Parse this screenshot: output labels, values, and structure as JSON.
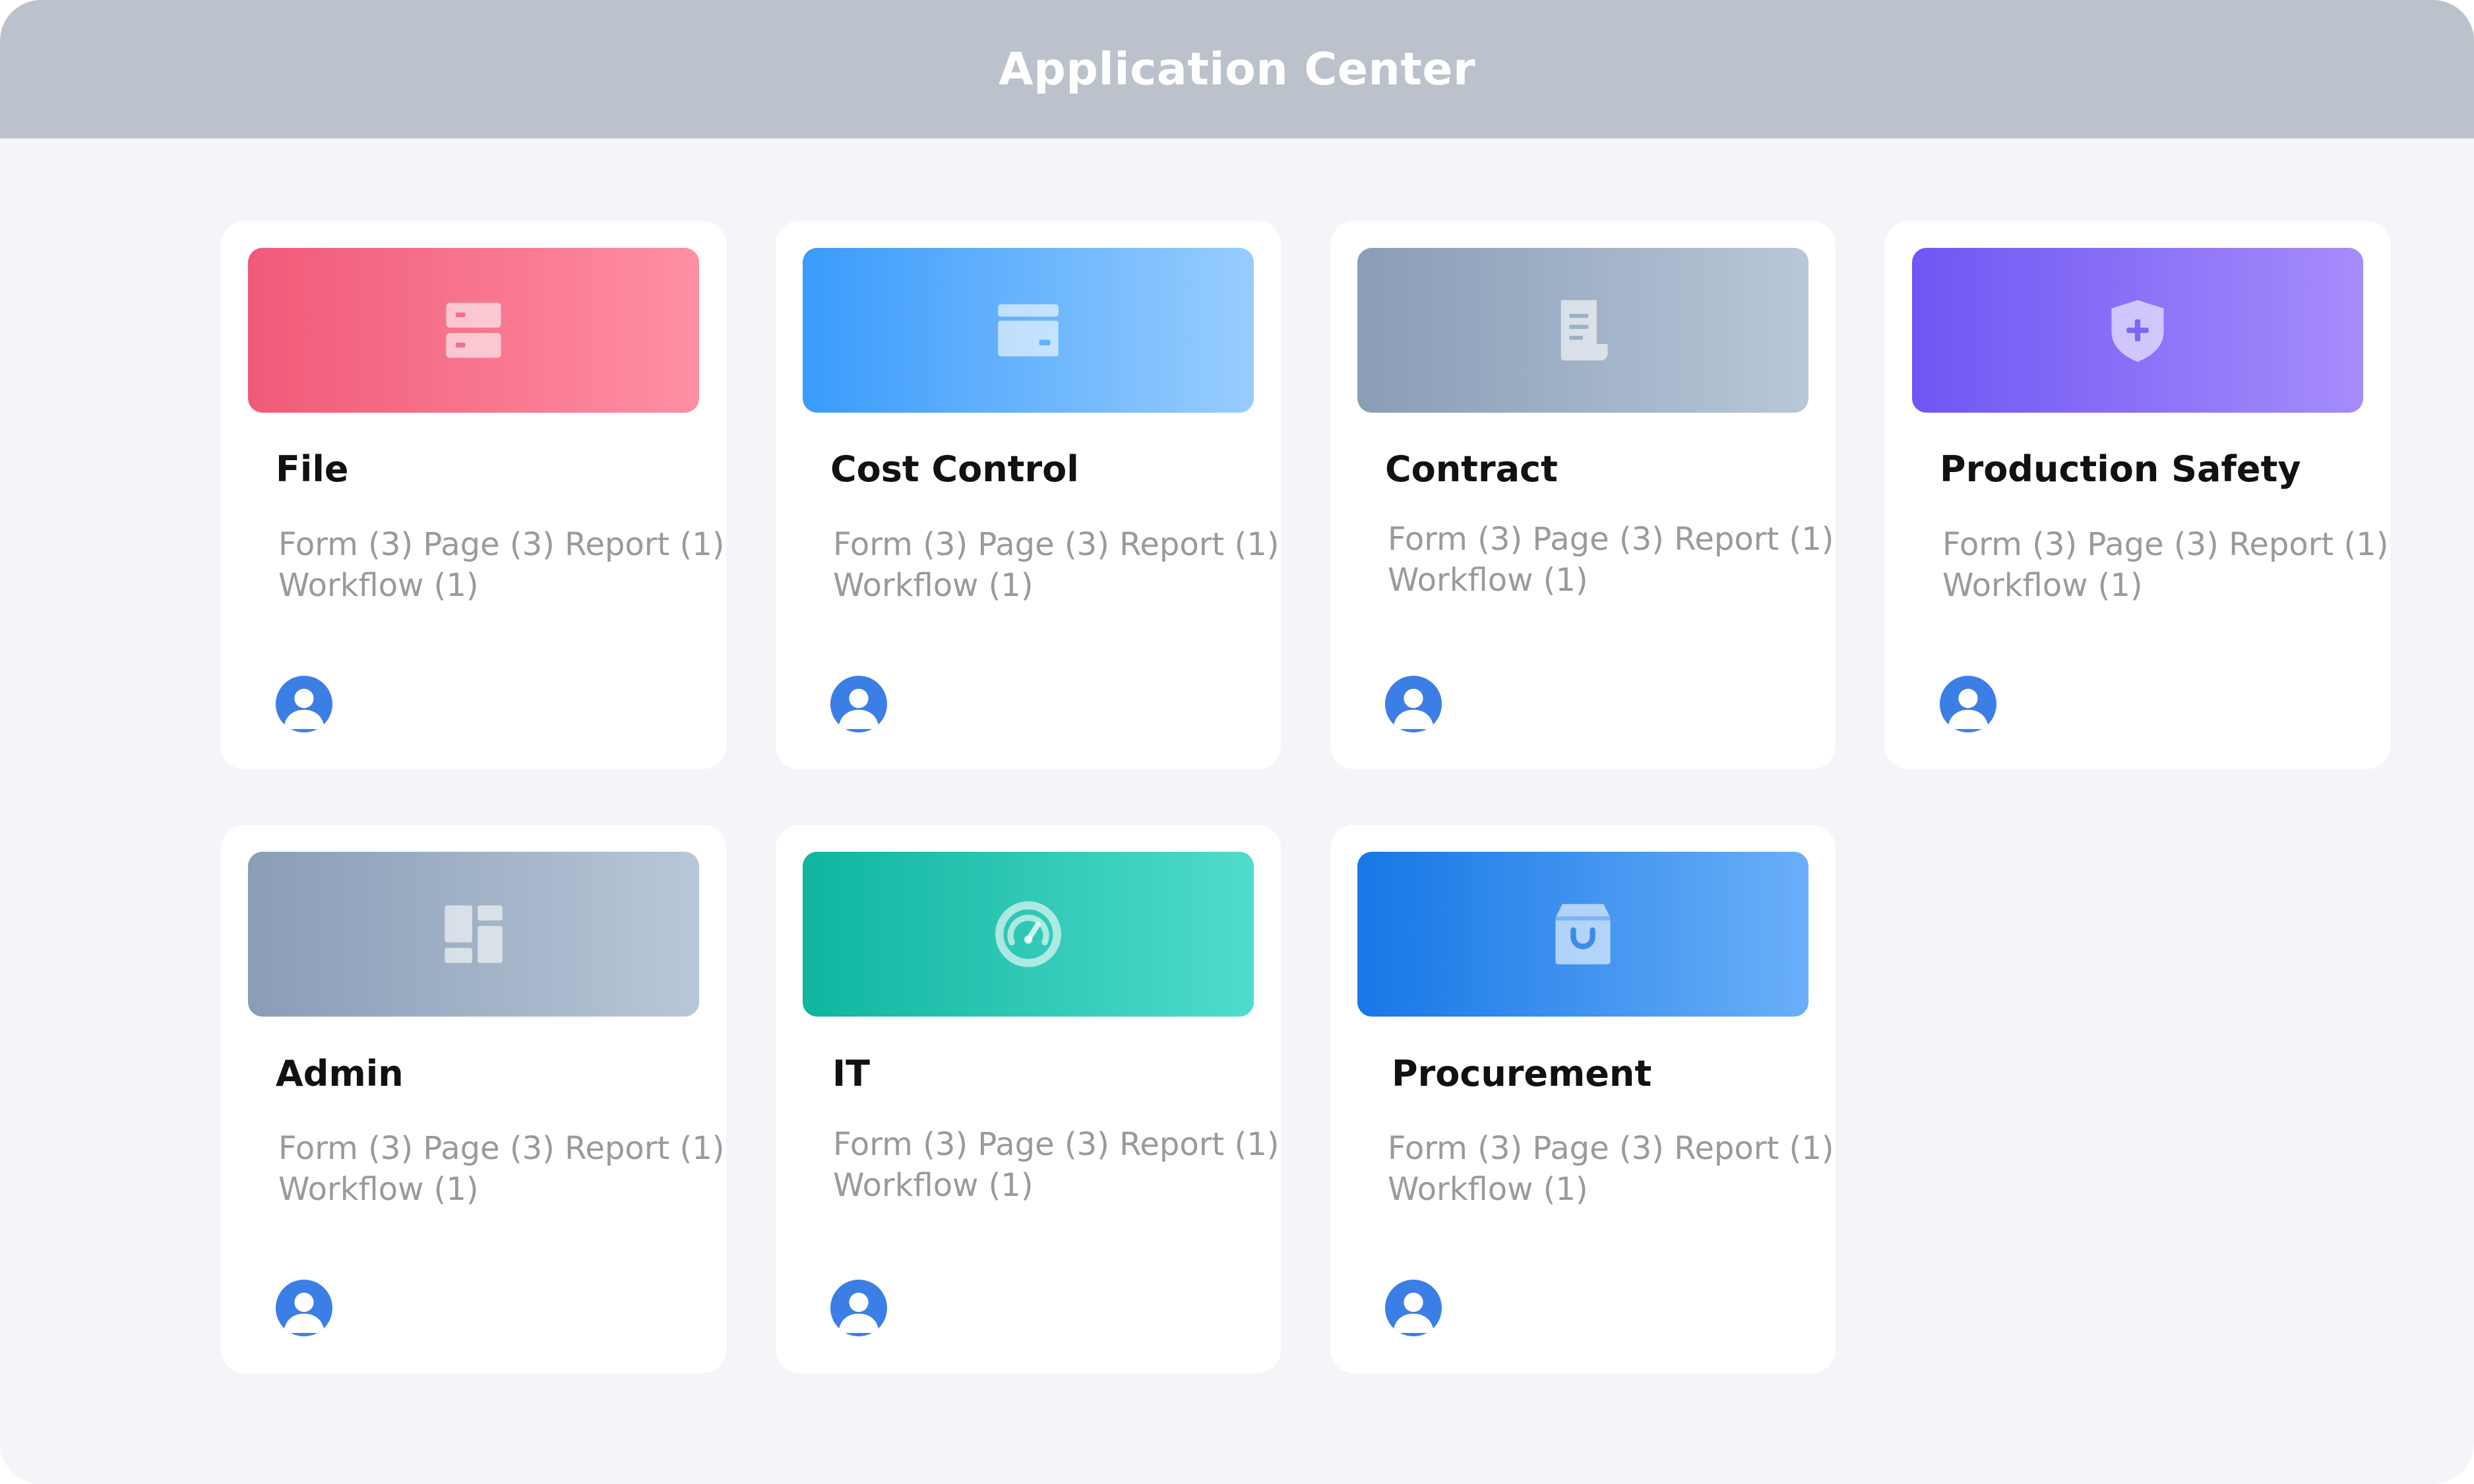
{
  "window": {
    "title": "Application Center",
    "background": "#f4f5f8",
    "titlebar_color": "#bcc2cb"
  },
  "apps": [
    {
      "name": "File",
      "stats_line1": "Form (3) Page (3) Report (1)",
      "stats_line2": "Workflow (1)",
      "icon": "storage-drawers-icon",
      "gradient": [
        "#f05a78",
        "#ff8fa3"
      ]
    },
    {
      "name": "Cost Control",
      "stats_line1": "Form (3) Page (3) Report (1)",
      "stats_line2": "Workflow (1)",
      "icon": "credit-card-icon",
      "gradient": [
        "#3a9bfc",
        "#98cdff"
      ]
    },
    {
      "name": "Contract",
      "stats_line1": "Form (3) Page (3) Report (1)",
      "stats_line2": "Workflow (1)",
      "icon": "document-icon",
      "gradient": [
        "#8a9db6",
        "#b8c7d8"
      ]
    },
    {
      "name": "Production Safety",
      "stats_line1": "Form (3) Page (3) Report (1)",
      "stats_line2": "Workflow (1)",
      "icon": "shield-plus-icon",
      "gradient": [
        "#7056f3",
        "#a68cfb"
      ]
    },
    {
      "name": "Admin",
      "stats_line1": "Form (3) Page (3) Report (1)",
      "stats_line2": "Workflow (1)",
      "icon": "dashboard-layout-icon",
      "gradient": [
        "#8a9db6",
        "#b8c7d8"
      ]
    },
    {
      "name": "IT",
      "stats_line1": "Form (3) Page (3) Report (1)",
      "stats_line2": "Workflow (1)",
      "icon": "speedometer-icon",
      "gradient": [
        "#0fb5a0",
        "#50dccb"
      ]
    },
    {
      "name": "Procurement",
      "stats_line1": "Form (3) Page (3) Report (1)",
      "stats_line2": "Workflow (1)",
      "icon": "shopping-bag-icon",
      "gradient": [
        "#1677e6",
        "#6aaff8"
      ]
    }
  ],
  "avatar_color": "#3b7ee6"
}
